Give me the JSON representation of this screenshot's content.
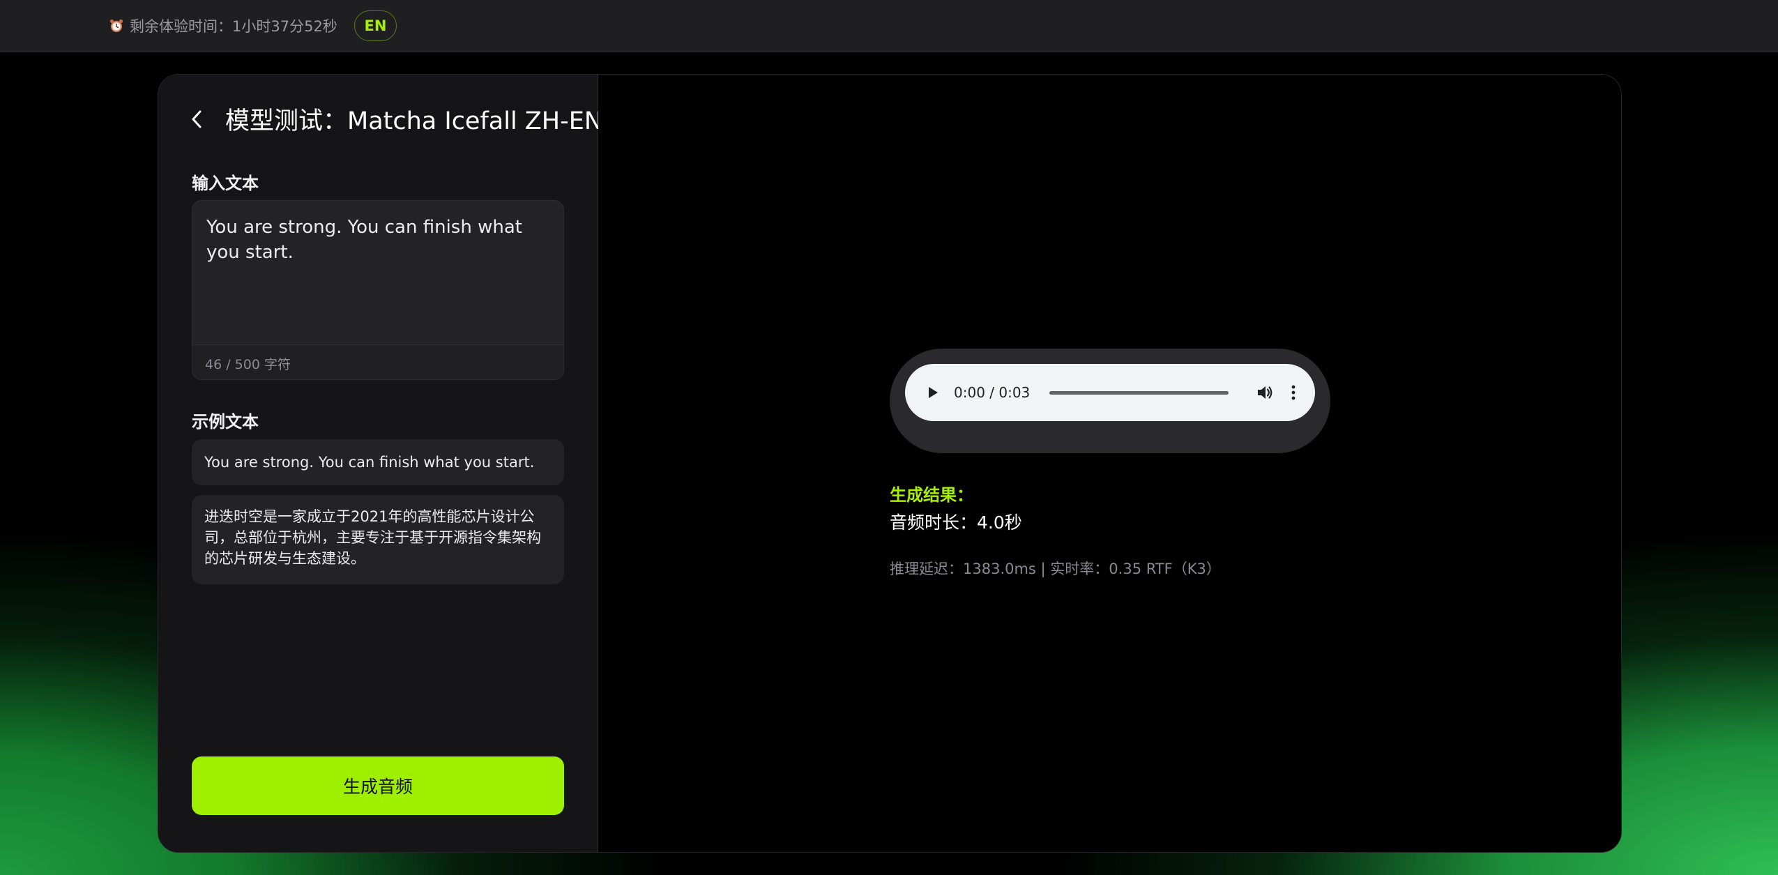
{
  "topbar": {
    "timer_text": "剩余体验时间：1小时37分52秒",
    "lang_button": "EN",
    "icons": {
      "timer": "alarm-clock-icon"
    },
    "accent_color": "#a8f000"
  },
  "left_panel": {
    "title": "模型测试：Matcha Icefall ZH-EN",
    "input_label": "输入文本",
    "input_value": "You are strong. You can finish what you start.",
    "char_counter": "46 / 500 字符",
    "examples_label": "示例文本",
    "examples": [
      "You are strong. You can finish what you start.",
      "进迭时空是一家成立于2021年的高性能芯片设计公司，总部位于杭州，主要专注于基于开源指令集架构的芯片研发与生态建设。"
    ],
    "generate_button": "生成音频",
    "button_color": "#9ff000"
  },
  "right_panel": {
    "audio_player": {
      "time": "0:00 / 0:03",
      "progress": 0
    },
    "result_label": "生成结果：",
    "duration_text": "音频时长：4.0秒",
    "metrics_text": "推理延迟：1383.0ms  |  实时率：0.35 RTF（K3）"
  }
}
